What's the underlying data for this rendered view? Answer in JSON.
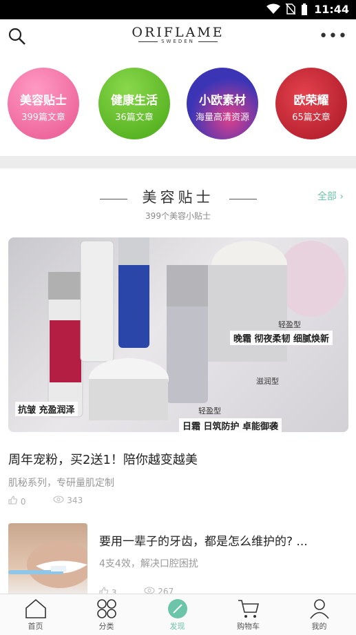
{
  "status": {
    "time": "11:44"
  },
  "brand": {
    "name": "ORIFLAME",
    "sub": "SWEDEN"
  },
  "categories": [
    {
      "title": "美容贴士",
      "sub": "399篇文章",
      "color": "#f06aa0"
    },
    {
      "title": "健康生活",
      "sub": "36篇文章",
      "color": "#5fbf2a"
    },
    {
      "title": "小欧素材",
      "sub": "海量高清资源",
      "color": "#4a3fb8"
    },
    {
      "title": "欧荣耀",
      "sub": "65篇文章",
      "color": "#c2232f"
    }
  ],
  "section": {
    "title": "美容贴士",
    "subtitle": "399个美容小贴士",
    "all_label": "全部"
  },
  "hero_labels": {
    "left": "抗皱 充盈润泽",
    "night": "晚霜 彻夜柔韧 细腻焕新",
    "day": "日霜 日筑防护 卓能御袭",
    "light1": "轻盈型",
    "light2": "轻盈型",
    "rich": "滋润型"
  },
  "articles": [
    {
      "title": "周年宠粉，买2送1！陪你越变越美",
      "sub": "肌秘系列，专研量肌定制",
      "likes": "0",
      "views": "343"
    },
    {
      "title": "要用一辈子的牙齿，都是怎么维护的? ...",
      "sub": "4支4效，解决口腔困扰",
      "likes": "3",
      "views": "267"
    }
  ],
  "tabs": [
    "首页",
    "分类",
    "发现",
    "购物车",
    "我的"
  ]
}
